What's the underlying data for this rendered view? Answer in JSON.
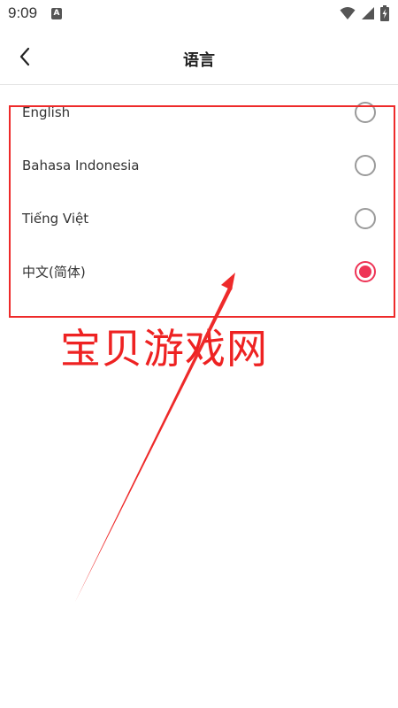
{
  "status_bar": {
    "time": "9:09",
    "notification_icon": "A",
    "icons": [
      "wifi-icon",
      "signal-icon",
      "battery-charging-icon"
    ]
  },
  "header": {
    "title": "语言",
    "back_icon": "chevron-left-icon"
  },
  "languages": [
    {
      "label": "English",
      "selected": false
    },
    {
      "label": "Bahasa Indonesia",
      "selected": false
    },
    {
      "label": "Tiếng Việt",
      "selected": false
    },
    {
      "label": "中文(简体)",
      "selected": true
    }
  ],
  "overlay": {
    "watermark": "宝贝游戏网",
    "accent_color": "#ee2a2a",
    "radio_selected_color": "#ee3355"
  }
}
